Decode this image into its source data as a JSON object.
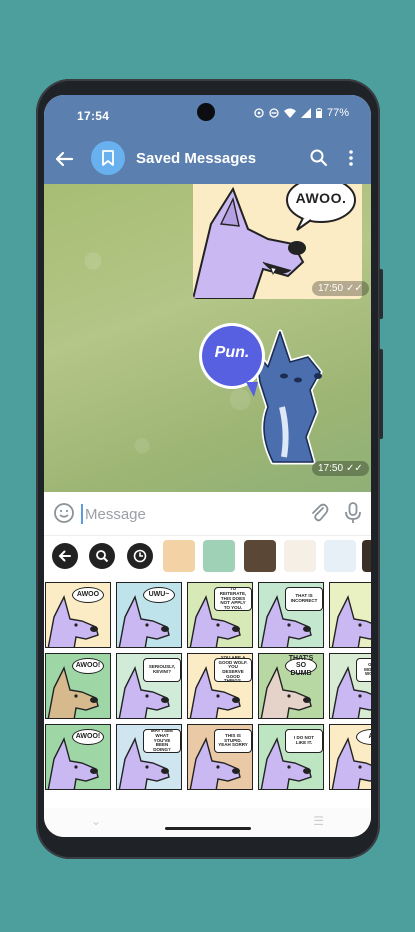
{
  "status_bar": {
    "time": "17:54",
    "battery": "77%"
  },
  "header": {
    "title": "Saved Messages"
  },
  "messages": [
    {
      "type": "sticker",
      "text": "AWOO.",
      "time": "17:50"
    },
    {
      "type": "sticker",
      "text": "Pun.",
      "time": "17:50"
    }
  ],
  "composer": {
    "placeholder": "Message"
  },
  "sticker_grid": [
    {
      "text": "AWOO",
      "bg": "#fbecc5",
      "fur": "#c9b8f2"
    },
    {
      "text": "UWU~",
      "bg": "#bfe3ea",
      "fur": "#c9b8f2"
    },
    {
      "text": "TO REITERATE, THIS DOES NOT APPLY TO YOU.",
      "bg": "#d8e9b8",
      "fur": "#c9b8f2"
    },
    {
      "text": "THAT IS INCORRECT",
      "bg": "#c4e8cf",
      "fur": "#c9b8f2"
    },
    {
      "text": "",
      "bg": "#e9f0c2",
      "fur": "#c9b8f2"
    },
    {
      "text": "AWOO!",
      "bg": "#9ed6a6",
      "fur": "#d6b98d"
    },
    {
      "text": "SERIOUSLY, KEVIN!?",
      "bg": "#d0ecd9",
      "fur": "#c9b8f2"
    },
    {
      "text": "YOU ARE A GOOD WOLF. YOU DESERVE GOOD THINGS.",
      "bg": "#fbecc5",
      "fur": "#c9b8f2"
    },
    {
      "text": "THAT'S SO DUMB",
      "bg": "#b7d7a3",
      "fur": "#e5d3c9"
    },
    {
      "text": "GOOD MORNING WORLD!!",
      "bg": "#d7ecd3",
      "fur": "#c9b8f2"
    },
    {
      "text": "AWOO!",
      "bg": "#9ed6a6",
      "fur": "#c9b8f2"
    },
    {
      "text": "MAY I SEE WHAT YOU'VE BEEN DOING?",
      "bg": "#cfe6f0",
      "fur": "#c9b8f2"
    },
    {
      "text": "THIS IS STUPID. YEAH SORRY",
      "bg": "#e9c9a6",
      "fur": "#c9b8f2"
    },
    {
      "text": "I DO NOT LIKE IT.",
      "bg": "#bde5c2",
      "fur": "#c9b8f2"
    },
    {
      "text": "A.",
      "bg": "#fbecc5",
      "fur": "#c9b8f2"
    }
  ],
  "colors": {
    "header": "#5b7fae",
    "accent": "#69b0ee",
    "background": "#4d9f9d"
  }
}
